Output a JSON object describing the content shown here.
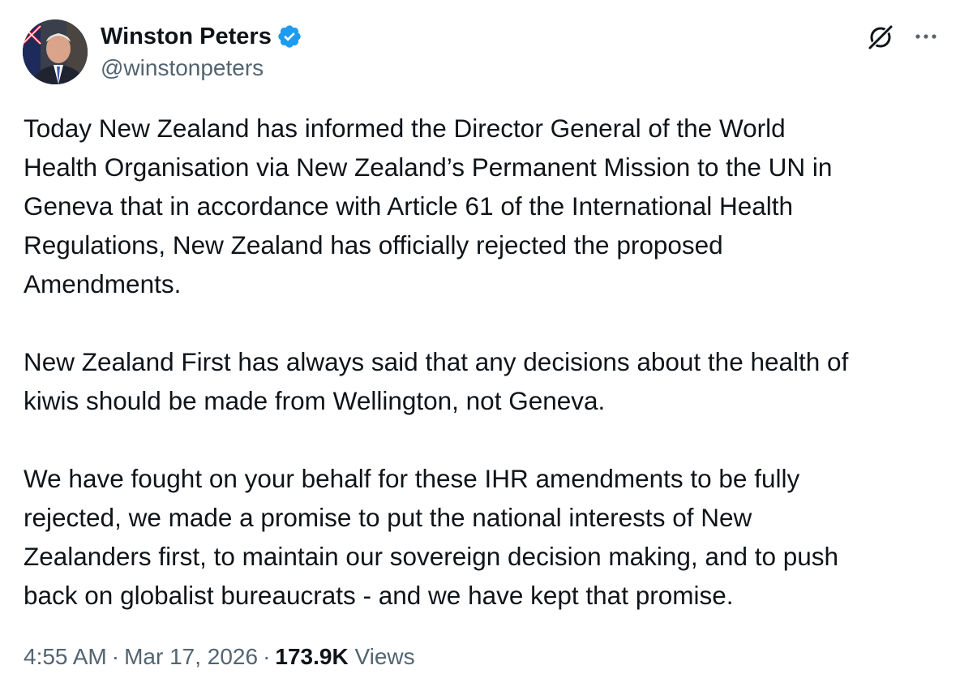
{
  "author": {
    "display_name": "Winston Peters",
    "handle": "@winstonpeters",
    "verified_icon": "verified-badge-icon",
    "verified_color": "#1d9bf0"
  },
  "icons": {
    "grok": "grok-icon",
    "more": "more-options-icon"
  },
  "tweet": {
    "paragraphs": [
      "Today New Zealand has informed the Director General of the World\nHealth Organisation via New Zealand’s Permanent Mission to the UN in\nGeneva that in accordance with Article 61 of the International Health\nRegulations, New Zealand has officially rejected the proposed\nAmendments.",
      "New Zealand First has always said that any decisions about the health of\nkiwis should be made from Wellington, not Geneva.",
      "We have fought on your behalf for these IHR amendments to be fully\nrejected, we made a promise to put the national interests of New\nZealanders first, to maintain our sovereign decision making, and to push\nback on globalist bureaucrats - and we have kept that promise."
    ]
  },
  "meta": {
    "time": "4:55 AM",
    "separator": "·",
    "date": "Mar 17, 2026",
    "views_count": "173.9K",
    "views_label": "Views"
  },
  "colors": {
    "text_primary": "#0f1419",
    "text_secondary": "#536471",
    "accent": "#1d9bf0"
  }
}
